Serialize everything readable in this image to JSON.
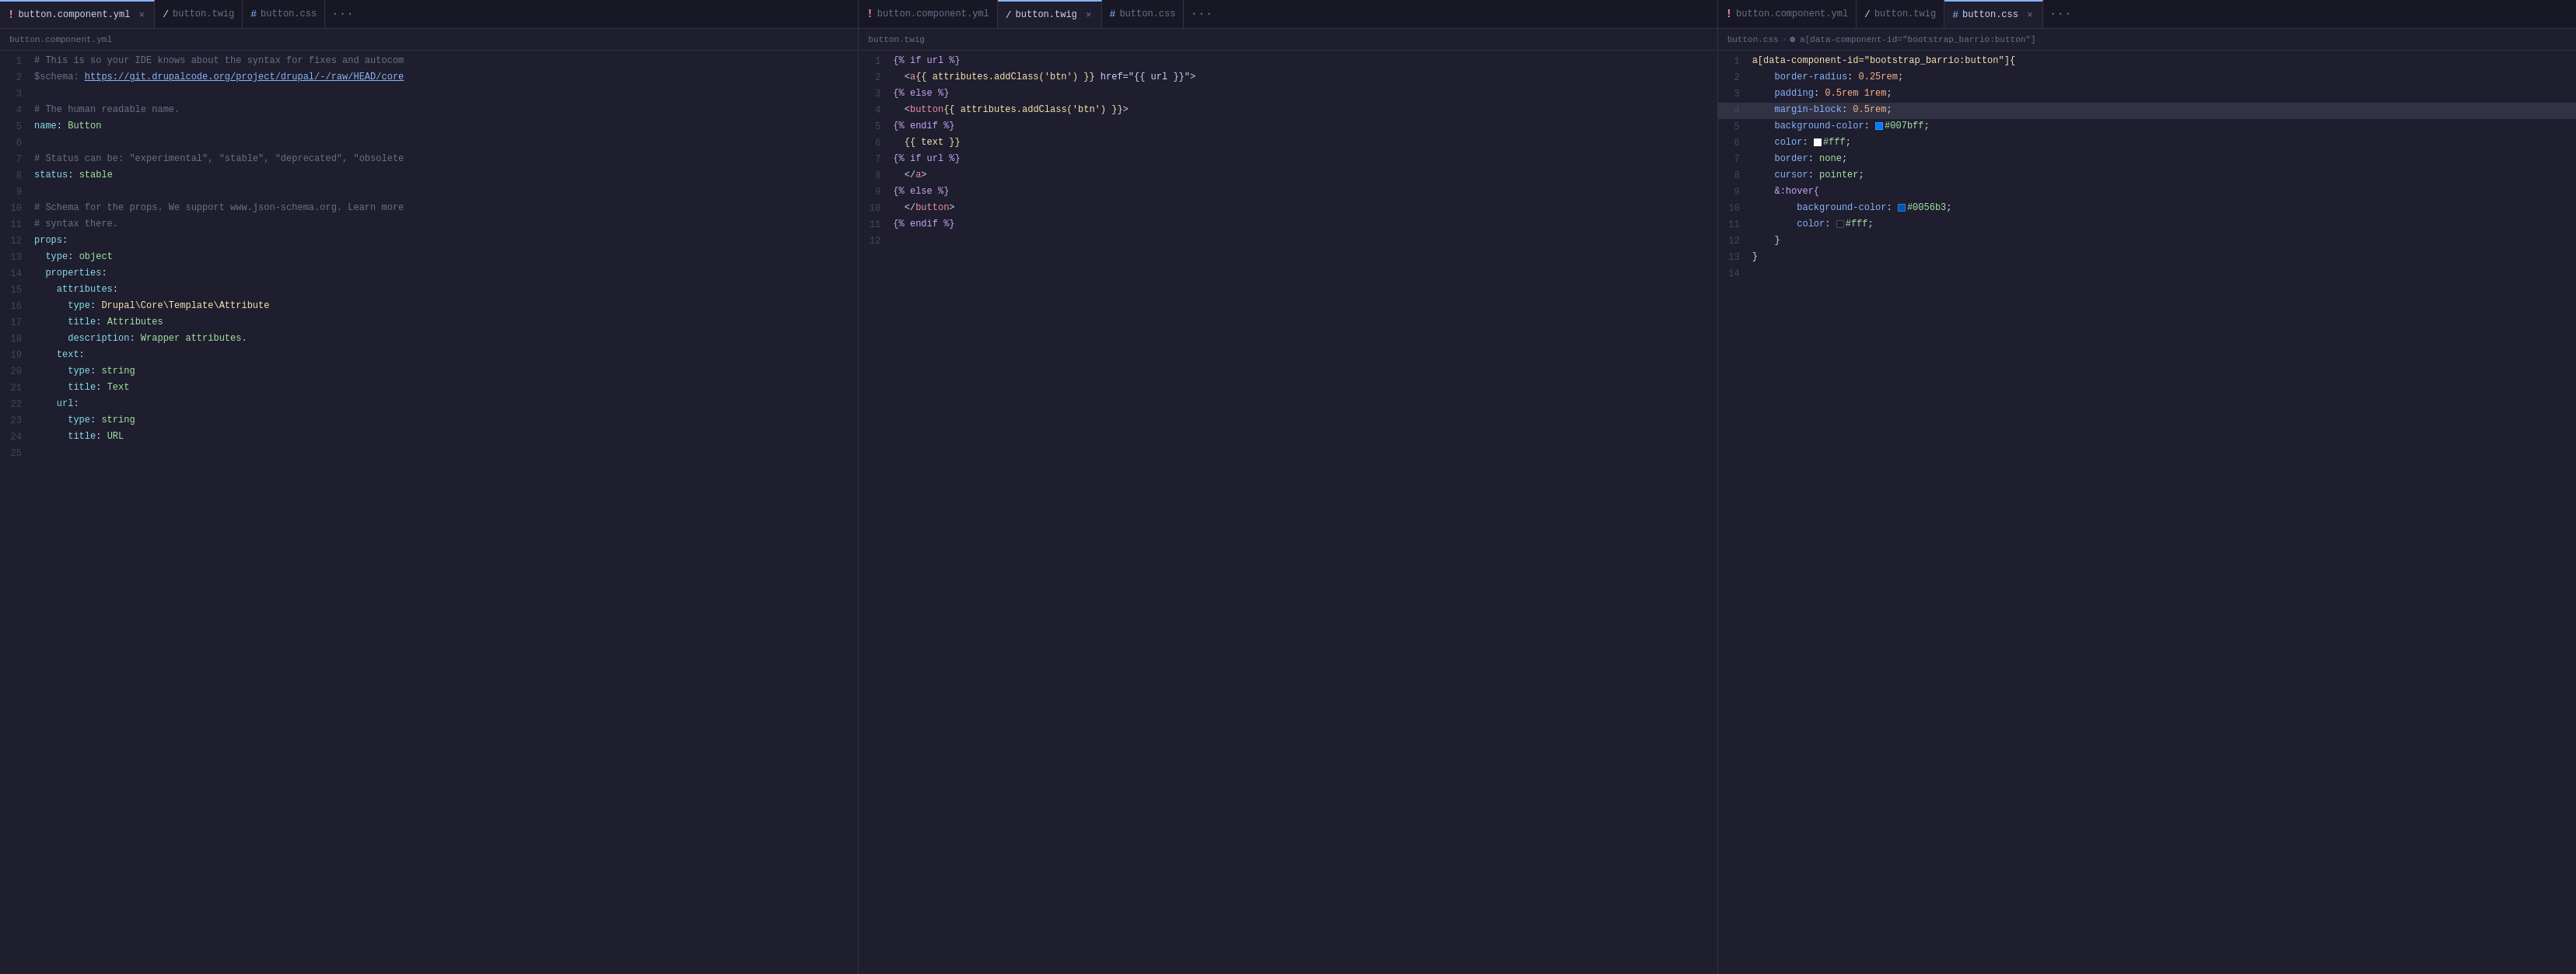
{
  "panels": [
    {
      "id": "panel1",
      "tabs": [
        {
          "id": "t1",
          "label": "button.component.yml",
          "icon": "dot",
          "active": true,
          "closable": true
        },
        {
          "id": "t2",
          "label": "button.twig",
          "icon": "slash",
          "active": false,
          "closable": false
        },
        {
          "id": "t3",
          "label": "button.css",
          "icon": "hash",
          "active": false,
          "closable": false
        }
      ],
      "ellipsis": true,
      "breadcrumb": "button.component.yml",
      "lines": [
        {
          "num": 1,
          "tokens": [
            {
              "text": "# This is so your IDE knows about the syntax for fixes and autocom",
              "cls": "c-comment"
            }
          ]
        },
        {
          "num": 2,
          "tokens": [
            {
              "text": "$schema: ",
              "cls": "c-comment"
            },
            {
              "text": "https://git.drupalcode.org/project/drupal/-/raw/HEAD/core",
              "cls": "c-link"
            }
          ]
        },
        {
          "num": 3,
          "tokens": []
        },
        {
          "num": 4,
          "tokens": [
            {
              "text": "# The human readable name.",
              "cls": "c-comment"
            }
          ]
        },
        {
          "num": 5,
          "tokens": [
            {
              "text": "name",
              "cls": "c-key"
            },
            {
              "text": ": ",
              "cls": "c-white"
            },
            {
              "text": "Button",
              "cls": "c-value"
            }
          ]
        },
        {
          "num": 6,
          "tokens": []
        },
        {
          "num": 7,
          "tokens": [
            {
              "text": "# Status can be: \"experimental\", \"stable\", \"deprecated\", \"obsolete",
              "cls": "c-comment"
            }
          ]
        },
        {
          "num": 8,
          "tokens": [
            {
              "text": "status",
              "cls": "c-key"
            },
            {
              "text": ": ",
              "cls": "c-white"
            },
            {
              "text": "stable",
              "cls": "c-value"
            }
          ]
        },
        {
          "num": 9,
          "tokens": []
        },
        {
          "num": 10,
          "tokens": [
            {
              "text": "# Schema for the props. We support www.json-schema.org. Learn more",
              "cls": "c-comment"
            }
          ]
        },
        {
          "num": 11,
          "tokens": [
            {
              "text": "# syntax there.",
              "cls": "c-comment"
            }
          ]
        },
        {
          "num": 12,
          "tokens": [
            {
              "text": "props",
              "cls": "c-key"
            },
            {
              "text": ":",
              "cls": "c-white"
            }
          ]
        },
        {
          "num": 13,
          "tokens": [
            {
              "text": "  type",
              "cls": "c-key"
            },
            {
              "text": ": ",
              "cls": "c-white"
            },
            {
              "text": "object",
              "cls": "c-value"
            }
          ]
        },
        {
          "num": 14,
          "tokens": [
            {
              "text": "  properties",
              "cls": "c-key"
            },
            {
              "text": ":",
              "cls": "c-white"
            }
          ]
        },
        {
          "num": 15,
          "tokens": [
            {
              "text": "    attributes",
              "cls": "c-key"
            },
            {
              "text": ":",
              "cls": "c-white"
            }
          ]
        },
        {
          "num": 16,
          "tokens": [
            {
              "text": "      type",
              "cls": "c-key"
            },
            {
              "text": ": ",
              "cls": "c-white"
            },
            {
              "text": "Drupal\\Core\\Template\\Attribute",
              "cls": "c-yellow"
            }
          ]
        },
        {
          "num": 17,
          "tokens": [
            {
              "text": "      title",
              "cls": "c-key"
            },
            {
              "text": ": ",
              "cls": "c-white"
            },
            {
              "text": "Attributes",
              "cls": "c-value"
            }
          ]
        },
        {
          "num": 18,
          "tokens": [
            {
              "text": "      description",
              "cls": "c-key"
            },
            {
              "text": ": ",
              "cls": "c-white"
            },
            {
              "text": "Wrapper attributes.",
              "cls": "c-value"
            }
          ]
        },
        {
          "num": 19,
          "tokens": [
            {
              "text": "    text",
              "cls": "c-key"
            },
            {
              "text": ":",
              "cls": "c-white"
            }
          ]
        },
        {
          "num": 20,
          "tokens": [
            {
              "text": "      type",
              "cls": "c-key"
            },
            {
              "text": ": ",
              "cls": "c-white"
            },
            {
              "text": "string",
              "cls": "c-value"
            }
          ]
        },
        {
          "num": 21,
          "tokens": [
            {
              "text": "      title",
              "cls": "c-key"
            },
            {
              "text": ": ",
              "cls": "c-white"
            },
            {
              "text": "Text",
              "cls": "c-value"
            }
          ]
        },
        {
          "num": 22,
          "tokens": [
            {
              "text": "    url",
              "cls": "c-key"
            },
            {
              "text": ":",
              "cls": "c-white"
            }
          ]
        },
        {
          "num": 23,
          "tokens": [
            {
              "text": "      type",
              "cls": "c-key"
            },
            {
              "text": ": ",
              "cls": "c-white"
            },
            {
              "text": "string",
              "cls": "c-value"
            }
          ]
        },
        {
          "num": 24,
          "tokens": [
            {
              "text": "      title",
              "cls": "c-key"
            },
            {
              "text": ": ",
              "cls": "c-white"
            },
            {
              "text": "URL",
              "cls": "c-value"
            }
          ]
        },
        {
          "num": 25,
          "tokens": []
        }
      ]
    },
    {
      "id": "panel2",
      "tabs": [
        {
          "id": "t4",
          "label": "button.component.yml",
          "icon": "dot",
          "active": false,
          "closable": false
        },
        {
          "id": "t5",
          "label": "button.twig",
          "icon": "slash",
          "active": true,
          "closable": true
        },
        {
          "id": "t6",
          "label": "button.css",
          "icon": "hash",
          "active": false,
          "closable": false
        }
      ],
      "ellipsis": true,
      "breadcrumb": "button.twig",
      "lines": [
        {
          "num": 1,
          "tokens": [
            {
              "text": "{% if url %}",
              "cls": "c-pink"
            }
          ]
        },
        {
          "num": 2,
          "tokens": [
            {
              "text": "  <",
              "cls": "c-white"
            },
            {
              "text": "a",
              "cls": "c-tag"
            },
            {
              "text": "{{ attributes.addClass('btn') }}",
              "cls": "c-yellow"
            },
            {
              "text": " href=\"{{ url }}\">",
              "cls": "c-white"
            }
          ]
        },
        {
          "num": 3,
          "tokens": [
            {
              "text": "{% else %}",
              "cls": "c-pink"
            }
          ]
        },
        {
          "num": 4,
          "tokens": [
            {
              "text": "  <",
              "cls": "c-white"
            },
            {
              "text": "button",
              "cls": "c-tag"
            },
            {
              "text": "{{ attributes.addClass('btn') }}",
              "cls": "c-yellow"
            },
            {
              "text": ">",
              "cls": "c-white"
            }
          ]
        },
        {
          "num": 5,
          "tokens": [
            {
              "text": "{% endif %}",
              "cls": "c-pink"
            }
          ]
        },
        {
          "num": 6,
          "tokens": [
            {
              "text": "  {{ text }}",
              "cls": "c-yellow"
            }
          ]
        },
        {
          "num": 7,
          "tokens": [
            {
              "text": "{% if url %}",
              "cls": "c-pink"
            }
          ]
        },
        {
          "num": 8,
          "tokens": [
            {
              "text": "  </",
              "cls": "c-white"
            },
            {
              "text": "a",
              "cls": "c-tag"
            },
            {
              "text": ">",
              "cls": "c-white"
            }
          ]
        },
        {
          "num": 9,
          "tokens": [
            {
              "text": "{% else %}",
              "cls": "c-pink"
            }
          ]
        },
        {
          "num": 10,
          "tokens": [
            {
              "text": "  </",
              "cls": "c-white"
            },
            {
              "text": "button",
              "cls": "c-tag"
            },
            {
              "text": ">",
              "cls": "c-white"
            }
          ]
        },
        {
          "num": 11,
          "tokens": [
            {
              "text": "{% endif %}",
              "cls": "c-pink"
            }
          ]
        },
        {
          "num": 12,
          "tokens": []
        }
      ]
    },
    {
      "id": "panel3",
      "tabs": [
        {
          "id": "t7",
          "label": "button.component.yml",
          "icon": "dot",
          "active": false,
          "closable": false
        },
        {
          "id": "t8",
          "label": "button.twig",
          "icon": "slash",
          "active": false,
          "closable": false
        },
        {
          "id": "t9",
          "label": "button.css",
          "icon": "hash",
          "active": true,
          "closable": true
        }
      ],
      "ellipsis": true,
      "breadcrumb_parts": [
        "button.css",
        "a[data-component-id=\"bootstrap_barrio:button\"]"
      ],
      "lines": [
        {
          "num": 1,
          "tokens": [
            {
              "text": "a[data-component-id=\"bootstrap_barrio:button\"]{",
              "cls": "c-yellow"
            }
          ]
        },
        {
          "num": 2,
          "tokens": [
            {
              "text": "    border-radius",
              "cls": "c-blue"
            },
            {
              "text": ": ",
              "cls": "c-white"
            },
            {
              "text": "0.25rem",
              "cls": "c-orange"
            },
            {
              "text": ";",
              "cls": "c-white"
            }
          ]
        },
        {
          "num": 3,
          "tokens": [
            {
              "text": "    padding",
              "cls": "c-blue"
            },
            {
              "text": ": ",
              "cls": "c-white"
            },
            {
              "text": "0.5rem 1rem",
              "cls": "c-orange"
            },
            {
              "text": ";",
              "cls": "c-white"
            }
          ]
        },
        {
          "num": 4,
          "highlighted": true,
          "tokens": [
            {
              "text": "    margin-block",
              "cls": "c-blue"
            },
            {
              "text": ": ",
              "cls": "c-white"
            },
            {
              "text": "0.5rem",
              "cls": "c-orange"
            },
            {
              "text": ";",
              "cls": "c-white"
            }
          ]
        },
        {
          "num": 5,
          "tokens": [
            {
              "text": "    background-color",
              "cls": "c-blue"
            },
            {
              "text": ": ",
              "cls": "c-white"
            },
            {
              "text": "#007bff",
              "cls": "c-value",
              "swatch": "#007bff"
            },
            {
              "text": ";",
              "cls": "c-white"
            }
          ]
        },
        {
          "num": 6,
          "tokens": [
            {
              "text": "    color",
              "cls": "c-blue"
            },
            {
              "text": ": ",
              "cls": "c-white"
            },
            {
              "text": "#fff",
              "cls": "c-value",
              "swatch": "#ffffff"
            },
            {
              "text": ";",
              "cls": "c-white"
            }
          ]
        },
        {
          "num": 7,
          "tokens": [
            {
              "text": "    border",
              "cls": "c-blue"
            },
            {
              "text": ": ",
              "cls": "c-white"
            },
            {
              "text": "none",
              "cls": "c-value"
            },
            {
              "text": ";",
              "cls": "c-white"
            }
          ]
        },
        {
          "num": 8,
          "tokens": [
            {
              "text": "    cursor",
              "cls": "c-blue"
            },
            {
              "text": ": ",
              "cls": "c-white"
            },
            {
              "text": "pointer",
              "cls": "c-value"
            },
            {
              "text": ";",
              "cls": "c-white"
            }
          ]
        },
        {
          "num": 9,
          "tokens": [
            {
              "text": "    &:hover{",
              "cls": "c-pink"
            }
          ]
        },
        {
          "num": 10,
          "tokens": [
            {
              "text": "        background-color",
              "cls": "c-blue"
            },
            {
              "text": ": ",
              "cls": "c-white"
            },
            {
              "text": "#0056b3",
              "cls": "c-value",
              "swatch": "#0056b3"
            },
            {
              "text": ";",
              "cls": "c-white"
            }
          ]
        },
        {
          "num": 11,
          "tokens": [
            {
              "text": "        color",
              "cls": "c-blue"
            },
            {
              "text": ": ",
              "cls": "c-white"
            },
            {
              "text": "#fff",
              "cls": "c-value",
              "swatch": "#1a1a2e"
            },
            {
              "text": ";",
              "cls": "c-white"
            }
          ]
        },
        {
          "num": 12,
          "tokens": [
            {
              "text": "    }",
              "cls": "c-white"
            }
          ]
        },
        {
          "num": 13,
          "tokens": [
            {
              "text": "}",
              "cls": "c-white"
            }
          ]
        },
        {
          "num": 14,
          "tokens": []
        }
      ]
    }
  ],
  "icons": {
    "dot": "!",
    "slash": "/",
    "hash": "#",
    "close": "×",
    "ellipsis": "···",
    "breadcrumb_arrow": "›",
    "settings_icon": "⚙"
  }
}
